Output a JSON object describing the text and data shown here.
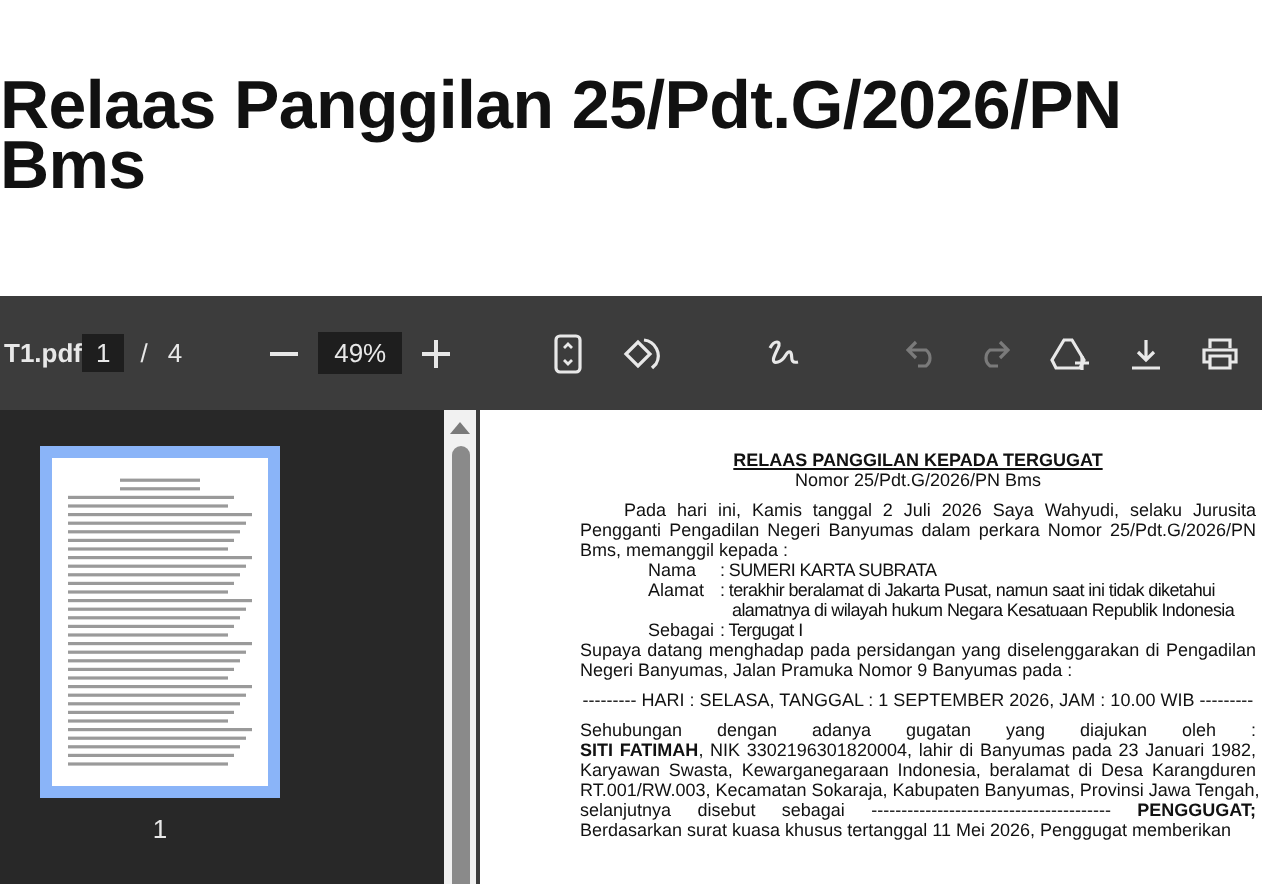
{
  "heading": "Relaas Panggilan 25/Pdt.G/2026/PN Bms",
  "toolbar": {
    "filename": "T1.pdf",
    "page": "1",
    "separator": "/",
    "page_count": "4",
    "zoom": "49%"
  },
  "thumbnails": [
    {
      "label": "1",
      "selected": true
    }
  ],
  "document": {
    "title": "RELAAS PANGGILAN KEPADA TERGUGAT",
    "number": "Nomor 25/Pdt.G/2026/PN Bms",
    "blocks": [
      {
        "kind": "paragraph",
        "lines": [
          "Pada hari ini, Kamis tanggal 2 Juli 2026 Saya Wahyudi, selaku Jurusita",
          "Pengganti Pengadilan Negeri Banyumas dalam perkara Nomor 25/Pdt.G/2026/PN",
          "Bms, memanggil kepada :"
        ]
      },
      {
        "kind": "field",
        "label": "Nama",
        "lines": [
          ": SUMERI KARTA SUBRATA"
        ]
      },
      {
        "kind": "field",
        "label": "Alamat",
        "lines": [
          ": terakhir beralamat di Jakarta Pusat, namun saat ini tidak diketahui",
          "alamatnya di wilayah hukum Negara Kesatuaan Republik Indonesia"
        ]
      },
      {
        "kind": "field",
        "label": "Sebagai",
        "lines": [
          ": Tergugat I"
        ]
      },
      {
        "kind": "paragraph",
        "lines": [
          "Supaya datang menghadap pada persidangan yang diselenggarakan di Pengadilan",
          "Negeri Banyumas, Jalan Pramuka Nomor 9 Banyumas pada :"
        ]
      },
      {
        "kind": "center",
        "lines": [
          "--------- HARI : SELASA, TANGGAL : 1 SEPTEMBER 2026, JAM : 10.00 WIB ---------"
        ]
      },
      {
        "kind": "paragraph",
        "lines": [
          "Sehubungan dengan adanya gugatan yang diajukan oleh :",
          "**SITI FATIMAH**, NIK 3302196301820004, lahir di Banyumas pada 23 Januari 1982,",
          "Karyawan Swasta, Kewarganegaraan Indonesia, beralamat di Desa Karangduren",
          "RT.001/RW.003, Kecamatan Sokaraja, Kabupaten Banyumas, Provinsi Jawa Tengah,",
          "selanjutnya disebut sebagai ---------------------------------------- **PENGGUGAT;**",
          "Berdasarkan surat kuasa khusus tertanggal  11 Mei 2026, Penggugat  memberikan"
        ]
      }
    ]
  }
}
